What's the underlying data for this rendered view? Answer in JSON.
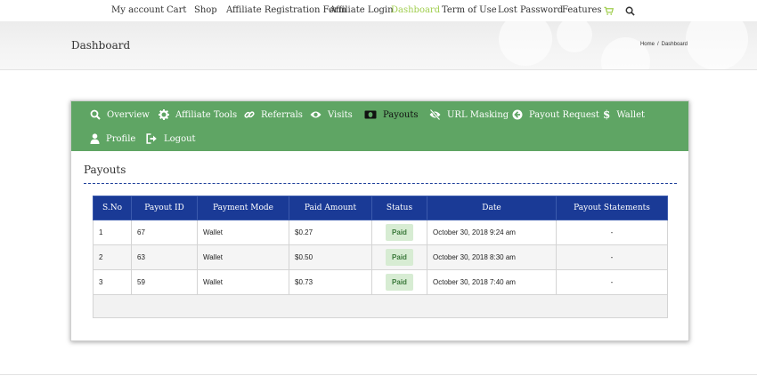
{
  "nav": {
    "items": [
      {
        "label": "My account"
      },
      {
        "label": "Cart"
      },
      {
        "label": "Shop"
      },
      {
        "label": "Affiliate Registration Form"
      },
      {
        "label": "Affiliate Login"
      },
      {
        "label": "Dashboard",
        "active": true
      },
      {
        "label": "Term of Use"
      },
      {
        "label": "Lost Password"
      },
      {
        "label": "Features"
      }
    ],
    "icons": [
      "cart-icon",
      "search-icon"
    ],
    "active_color": "#a0ce4e"
  },
  "header": {
    "title": "Dashboard",
    "breadcrumb": [
      "Home",
      "Dashboard"
    ],
    "breadcrumb_sep": "/"
  },
  "tabs": [
    {
      "label": "Overview",
      "icon": "search-icon"
    },
    {
      "label": "Affiliate Tools",
      "icon": "gear-icon"
    },
    {
      "label": "Referrals",
      "icon": "link-icon"
    },
    {
      "label": "Visits",
      "icon": "eye-icon"
    },
    {
      "label": "Payouts",
      "icon": "money-icon",
      "active": true
    },
    {
      "label": "URL Masking",
      "icon": "eye-slash-icon"
    },
    {
      "label": "Payout Request",
      "icon": "arrow-circle-left-icon"
    },
    {
      "label": "Wallet",
      "icon": "dollar-icon"
    },
    {
      "label": "Profile",
      "icon": "user-icon"
    },
    {
      "label": "Logout",
      "icon": "sign-out-icon"
    }
  ],
  "tabs_color": "#5fa564",
  "section": {
    "title": "Payouts",
    "columns": [
      "S.No",
      "Payout ID",
      "Payment Mode",
      "Paid Amount",
      "Status",
      "Date",
      "Payout Statements"
    ],
    "rows": [
      {
        "sno": "1",
        "payout_id": "67",
        "mode": "Wallet",
        "amount": "$0.27",
        "status": "Paid",
        "date": "October 30, 2018 9:24 am",
        "statement": "-"
      },
      {
        "sno": "2",
        "payout_id": "63",
        "mode": "Wallet",
        "amount": "$0.50",
        "status": "Paid",
        "date": "October 30, 2018 8:30 am",
        "statement": "-"
      },
      {
        "sno": "3",
        "payout_id": "59",
        "mode": "Wallet",
        "amount": "$0.73",
        "status": "Paid",
        "date": "October 30, 2018 7:40 am",
        "statement": "-"
      }
    ],
    "header_color": "#1a3a96",
    "badge_color": "#d7ecd3"
  }
}
